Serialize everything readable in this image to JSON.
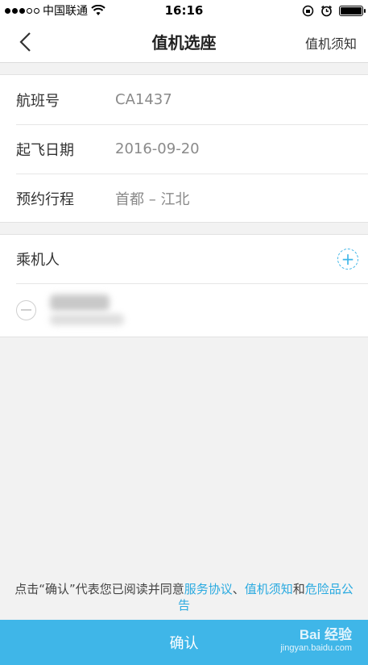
{
  "status_bar": {
    "carrier": "中国联通",
    "time": "16:16"
  },
  "nav": {
    "title": "值机选座",
    "right_link": "值机须知"
  },
  "flight": {
    "rows": [
      {
        "label": "航班号",
        "value": "CA1437"
      },
      {
        "label": "起飞日期",
        "value": "2016-09-20"
      },
      {
        "label": "预约行程",
        "value": "首都 – 江北"
      }
    ]
  },
  "passengers": {
    "header": "乘机人",
    "add_symbol": "+"
  },
  "agreement": {
    "prefix": "点击“确认”代表您已阅读并同意",
    "link1": "服务协议",
    "sep": "、",
    "link2": "值机须知",
    "and": "和",
    "link3": "危险品公告"
  },
  "confirm": {
    "label": "确认"
  },
  "watermark": {
    "brand": "Bai 经验",
    "url": "jingyan.baidu.com"
  },
  "colors": {
    "accent": "#3fb6e8",
    "link": "#2aaae0"
  }
}
